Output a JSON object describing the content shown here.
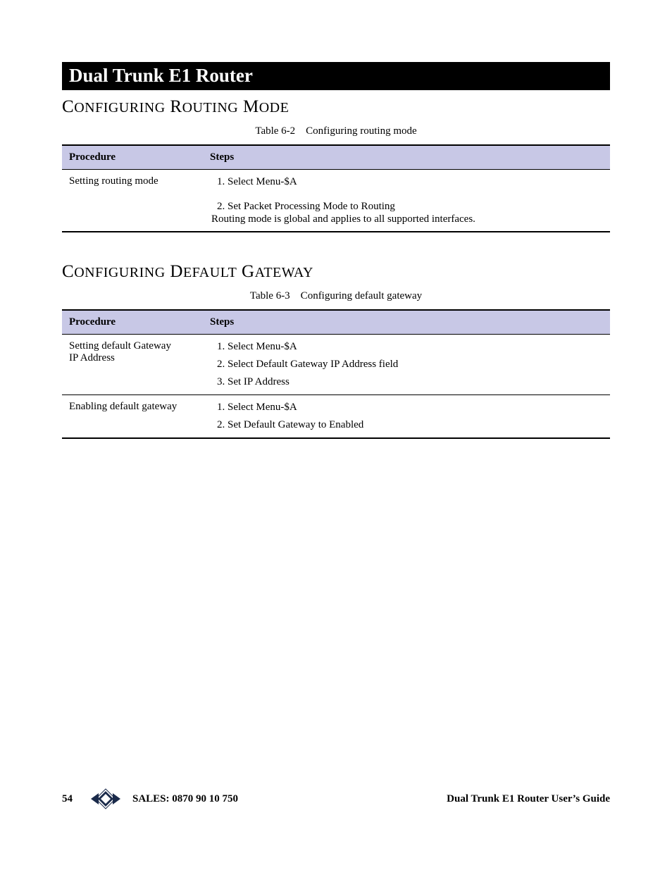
{
  "title_bar": "Dual Trunk E1 Router",
  "section1": {
    "heading_html": "C<span style=\"font-size:20px\">ONFIGURING</span> R<span style=\"font-size:20px\">OUTING</span> M<span style=\"font-size:20px\">ODE</span>",
    "table_caption": "Table 6-2 Configuring routing mode",
    "headers": {
      "procedure": "Procedure",
      "steps": "Steps"
    },
    "rows": [
      {
        "procedure": "Setting routing mode",
        "steps": [
          "1. Select Menu-$A",
          "2. Set Packet Processing Mode to Routing"
        ],
        "note": "Routing mode is global and applies to all supported interfaces."
      }
    ]
  },
  "section2": {
    "heading_html": "C<span style=\"font-size:20px\">ONFIGURING</span> D<span style=\"font-size:20px\">EFAULT</span> G<span style=\"font-size:20px\">ATEWAY</span>",
    "table_caption": "Table 6-3 Configuring default gateway",
    "headers": {
      "procedure": "Procedure",
      "steps": "Steps"
    },
    "rows": [
      {
        "procedure_lines": [
          "Setting default Gateway",
          "IP Address"
        ],
        "steps": [
          "1. Select Menu-$A",
          "2. Select Default Gateway IP Address field",
          "3. Set IP Address"
        ]
      },
      {
        "procedure_lines": [
          "Enabling default gateway"
        ],
        "steps": [
          "1. Select Menu-$A",
          "2. Set Default Gateway to Enabled"
        ]
      }
    ]
  },
  "footer": {
    "page_number": "54",
    "sales": "SALES: 0870 90 10 750",
    "guide": "Dual Trunk E1 Router User’s Guide"
  }
}
